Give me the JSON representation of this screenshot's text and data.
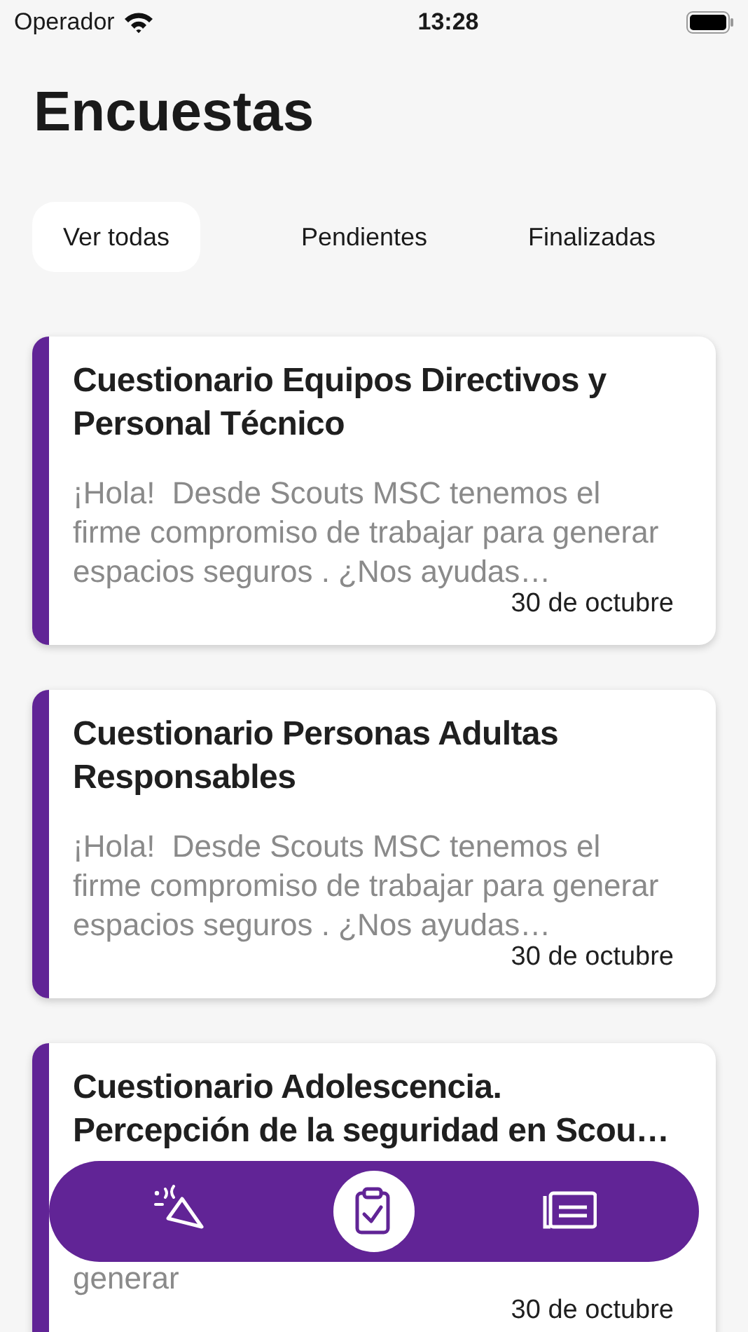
{
  "status_bar": {
    "carrier": "Operador",
    "time": "13:28"
  },
  "title": "Encuestas",
  "tabs": [
    {
      "label": "Ver todas",
      "selected": true
    },
    {
      "label": "Pendientes",
      "selected": false
    },
    {
      "label": "Finalizadas",
      "selected": false
    }
  ],
  "surveys": [
    {
      "title": "Cuestionario Equipos Directivos y Personal Técnico",
      "description": "¡Hola!  Desde Scouts MSC tenemos el firme compromiso de trabajar para generar espacios seguros . ¿Nos ayudas…",
      "date": "30 de octubre"
    },
    {
      "title": "Cuestionario Personas Adultas Responsables",
      "description": "¡Hola!  Desde Scouts MSC tenemos el firme compromiso de trabajar para generar espacios seguros . ¿Nos ayudas…",
      "date": "30 de octubre"
    },
    {
      "title": "Cuestionario Adolescencia. Percepción de la seguridad en Scou…",
      "description": "generar",
      "date": "30 de octubre"
    }
  ],
  "nav": [
    {
      "kind": "celebrate",
      "selected": false
    },
    {
      "kind": "surveys",
      "selected": true
    },
    {
      "kind": "news",
      "selected": false
    }
  ]
}
